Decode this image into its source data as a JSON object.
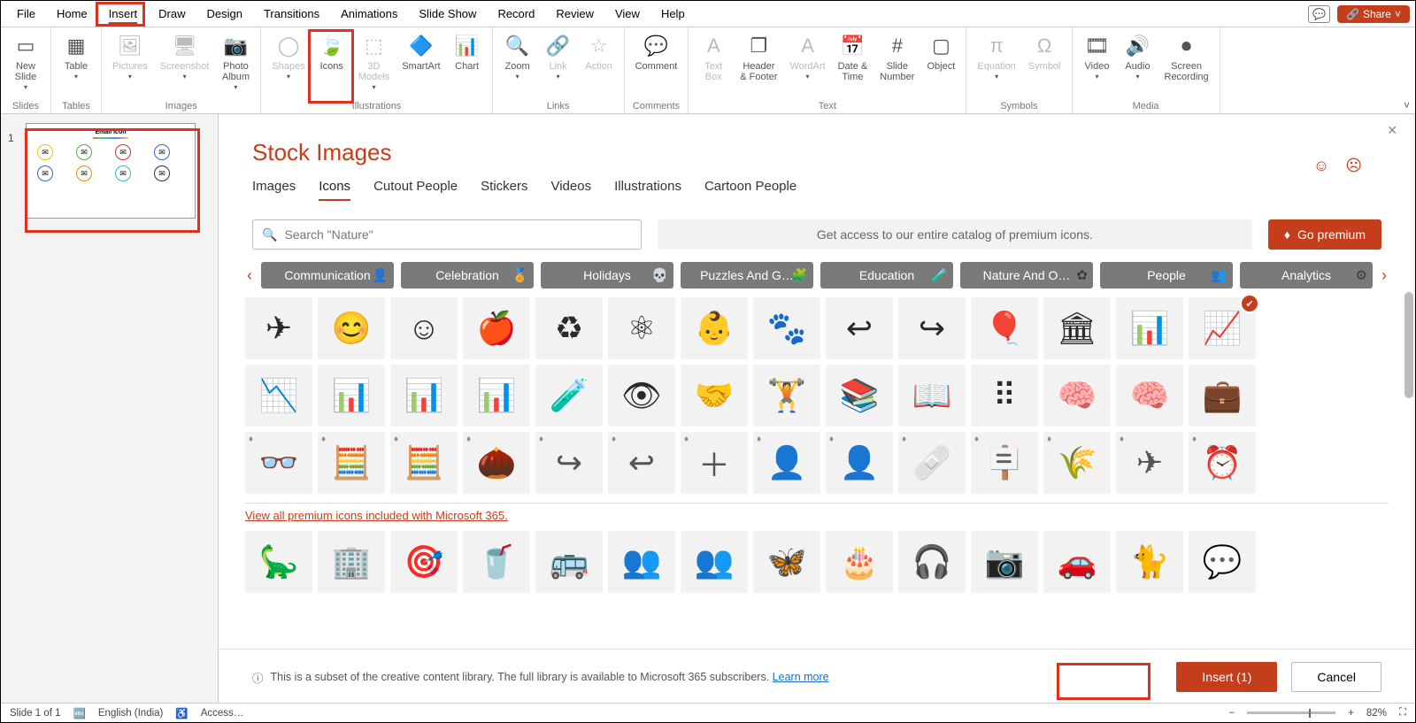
{
  "menu": {
    "items": [
      "File",
      "Home",
      "Insert",
      "Draw",
      "Design",
      "Transitions",
      "Animations",
      "Slide Show",
      "Record",
      "Review",
      "View",
      "Help"
    ],
    "active": "Insert",
    "share": "Share"
  },
  "ribbon": {
    "groups": [
      {
        "label": "Slides",
        "items": [
          {
            "label": "New\nSlide",
            "drop": true
          }
        ]
      },
      {
        "label": "Tables",
        "items": [
          {
            "label": "Table",
            "drop": true
          }
        ]
      },
      {
        "label": "Images",
        "items": [
          {
            "label": "Pictures",
            "drop": true,
            "disabled": true
          },
          {
            "label": "Screenshot",
            "drop": true,
            "disabled": true
          },
          {
            "label": "Photo\nAlbum",
            "drop": true
          }
        ]
      },
      {
        "label": "Illustrations",
        "items": [
          {
            "label": "Shapes",
            "drop": true,
            "disabled": true
          },
          {
            "label": "Icons"
          },
          {
            "label": "3D\nModels",
            "drop": true,
            "disabled": true
          },
          {
            "label": "SmartArt"
          },
          {
            "label": "Chart"
          }
        ]
      },
      {
        "label": "Links",
        "items": [
          {
            "label": "Zoom",
            "drop": true
          },
          {
            "label": "Link",
            "drop": true,
            "disabled": true
          },
          {
            "label": "Action",
            "disabled": true
          }
        ]
      },
      {
        "label": "Comments",
        "items": [
          {
            "label": "Comment"
          }
        ]
      },
      {
        "label": "Text",
        "items": [
          {
            "label": "Text\nBox",
            "disabled": true
          },
          {
            "label": "Header\n& Footer"
          },
          {
            "label": "WordArt",
            "drop": true,
            "disabled": true
          },
          {
            "label": "Date &\nTime"
          },
          {
            "label": "Slide\nNumber"
          },
          {
            "label": "Object"
          }
        ]
      },
      {
        "label": "Symbols",
        "items": [
          {
            "label": "Equation",
            "drop": true,
            "disabled": true
          },
          {
            "label": "Symbol",
            "disabled": true
          }
        ]
      },
      {
        "label": "Media",
        "items": [
          {
            "label": "Video",
            "drop": true
          },
          {
            "label": "Audio",
            "drop": true
          },
          {
            "label": "Screen\nRecording"
          }
        ]
      }
    ]
  },
  "slidePanel": {
    "num": "1",
    "thumbTitle": "Email Icon"
  },
  "stock": {
    "title": "Stock Images",
    "tabs": [
      "Images",
      "Icons",
      "Cutout People",
      "Stickers",
      "Videos",
      "Illustrations",
      "Cartoon People"
    ],
    "activeTab": "Icons",
    "searchPlaceholder": "Search \"Nature\"",
    "promo": "Get access to our entire catalog of premium icons.",
    "goPremium": "Go premium",
    "categories": [
      "Communication",
      "Celebration",
      "Holidays",
      "Puzzles And G…",
      "Education",
      "Nature And O…",
      "People",
      "Analytics"
    ],
    "premiumLink": "View all premium icons included with Microsoft 365.",
    "footerInfo": "This is a subset of the creative content library. The full library is available to Microsoft 365 subscribers.",
    "learnMore": "Learn more",
    "insertBtn": "Insert (1)",
    "cancelBtn": "Cancel"
  },
  "status": {
    "slide": "Slide 1 of 1",
    "lang": "English (India)",
    "access": "Access…",
    "zoom": "82%"
  }
}
